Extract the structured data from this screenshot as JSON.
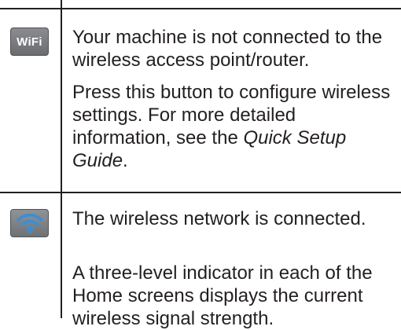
{
  "rows": [
    {
      "icon": "wifi-text-icon",
      "icon_label": "WiFi",
      "paragraph1": "Your machine is not connected to the wireless access point/router.",
      "paragraph2_prefix": "Press this button to configure wireless settings. For more detailed information, see the ",
      "paragraph2_italic": "Quick Setup Guide",
      "paragraph2_suffix": "."
    },
    {
      "icon": "wifi-signal-icon",
      "paragraph1": "The wireless network is connected.",
      "paragraph2": "A three-level indicator in each of the Home screens displays the current wireless signal strength."
    }
  ],
  "colors": {
    "text": "#231f20",
    "wifi_connected_blue": "#3a8fd6",
    "icon_gray": "#7b7d80"
  }
}
